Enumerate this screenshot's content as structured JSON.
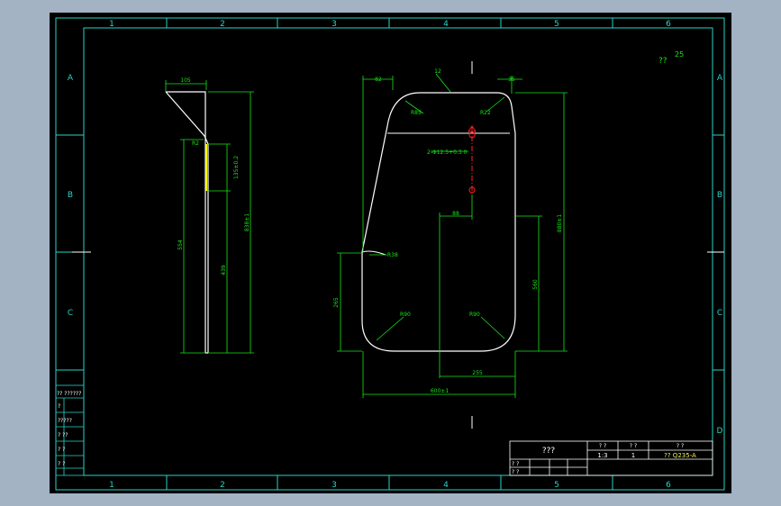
{
  "colors": {
    "background": "#a3b3c4",
    "sheet": "#000000",
    "frame": "#27d5c8",
    "part": "#ffffff",
    "dimension": "#19e619",
    "annotation": "#f0f050",
    "highlight": "#ff2020",
    "yellow_edge": "#ffff00"
  },
  "grid": {
    "columns": [
      "1",
      "2",
      "3",
      "4",
      "5",
      "6"
    ],
    "rows": [
      "A",
      "B",
      "C",
      "D"
    ]
  },
  "roughness": {
    "symbol": "??",
    "value": "25"
  },
  "side_view": {
    "dims": {
      "top_width": "105",
      "radius": "R2",
      "hole_pitch": "135±0.2",
      "total_height": "838±1",
      "left_height": "554",
      "lower_height": "439"
    }
  },
  "front_view": {
    "dims": {
      "top_left_offset": "82",
      "top_label": "12",
      "top_right_offset": "35",
      "r_top_left": "R85",
      "r_top_right": "R22",
      "holes": "2-Φ12.5+0.3 0",
      "hole_offset": "88",
      "right_height": "880±1",
      "lower_right_height": "560",
      "r_side": "R38",
      "left_height": "265",
      "r_bottom_left": "R90",
      "r_bottom_right": "R90",
      "bottom_half": "255",
      "bottom_width": "600±1"
    }
  },
  "left_table": {
    "rows": [
      "?? ??????",
      "?",
      "?????",
      "? ??",
      "? ?",
      "? ?"
    ]
  },
  "title_block": {
    "name": "???",
    "scale_header": "? ?",
    "qty_header": "? ?",
    "material_header": "? ?",
    "scale": "1:3",
    "qty": "1",
    "material": "?? Q235-A",
    "row_labels": [
      "? ?",
      "? ?"
    ]
  }
}
